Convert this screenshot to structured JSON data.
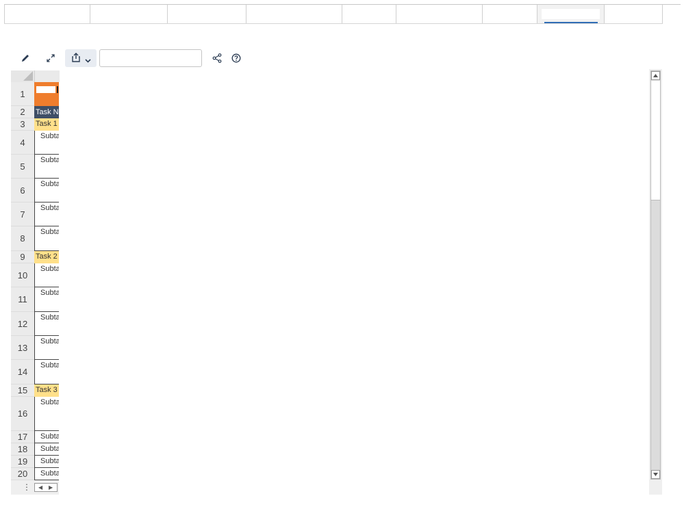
{
  "tabs": [
    {
      "label": ""
    },
    {
      "label": ""
    },
    {
      "label": ""
    },
    {
      "label": ""
    },
    {
      "label": ""
    },
    {
      "label": ""
    },
    {
      "label": ""
    },
    {
      "label": ""
    },
    {
      "label": ""
    }
  ],
  "active_tab_index": 7,
  "toolbar": {
    "edit_icon": "pencil-icon",
    "expand_icon": "expand-icon",
    "share_icon": "share-upload-icon",
    "network_icon": "share-network-icon",
    "help_icon": "help-icon",
    "search_value": "",
    "search_placeholder": ""
  },
  "sheet": {
    "rows": [
      {
        "num": "1",
        "type": "orange",
        "text": ""
      },
      {
        "num": "2",
        "type": "header",
        "text": "Task N"
      },
      {
        "num": "3",
        "type": "task",
        "text": "Task 1"
      },
      {
        "num": "4",
        "type": "sub",
        "text": "Subta"
      },
      {
        "num": "5",
        "type": "sub",
        "text": "Subta"
      },
      {
        "num": "6",
        "type": "sub",
        "text": "Subta"
      },
      {
        "num": "7",
        "type": "sub",
        "text": "Subta"
      },
      {
        "num": "8",
        "type": "sub",
        "text": "Subta"
      },
      {
        "num": "9",
        "type": "task",
        "text": "Task 2"
      },
      {
        "num": "10",
        "type": "sub",
        "text": "Subta"
      },
      {
        "num": "11",
        "type": "sub",
        "text": "Subta"
      },
      {
        "num": "12",
        "type": "sub",
        "text": "Subta"
      },
      {
        "num": "13",
        "type": "sub",
        "text": "Subta"
      },
      {
        "num": "14",
        "type": "sub",
        "text": "Subta"
      },
      {
        "num": "15",
        "type": "task",
        "text": "Task 3"
      },
      {
        "num": "16",
        "type": "sub",
        "text": "Subta"
      },
      {
        "num": "17",
        "type": "sub",
        "text": "Subta"
      },
      {
        "num": "18",
        "type": "sub",
        "text": "Subta"
      },
      {
        "num": "19",
        "type": "sub",
        "text": "Subta"
      },
      {
        "num": "20",
        "type": "sub",
        "text": "Subta"
      }
    ]
  },
  "colors": {
    "header_bg": "#3f4f66",
    "task_bg": "#ffe08a",
    "title_bg": "#ef7d2d",
    "tab_accent": "#2f6db5"
  }
}
